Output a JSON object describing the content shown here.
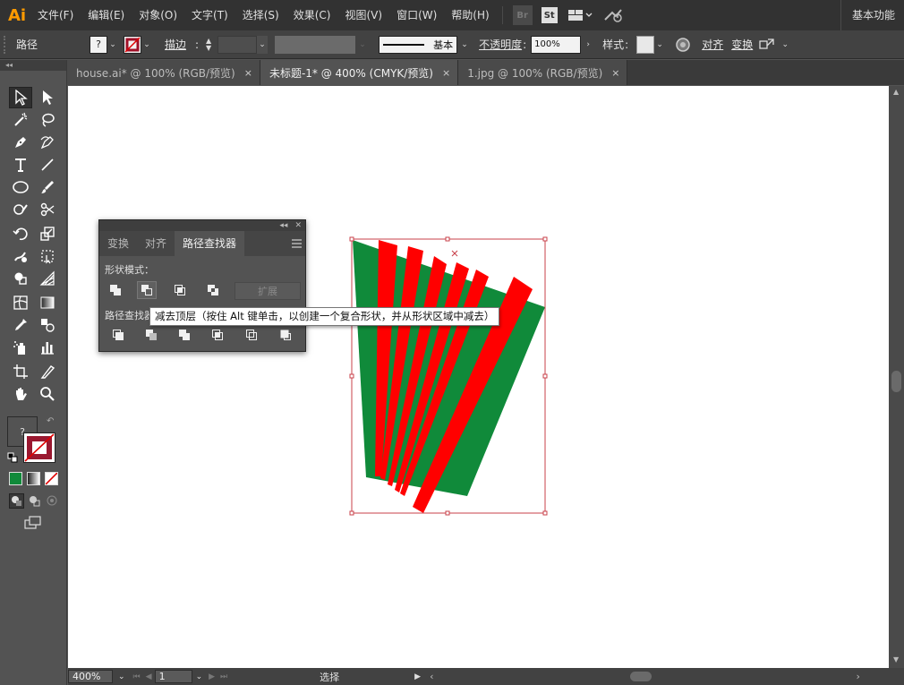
{
  "app": {
    "logo": "Ai",
    "workspace": "基本功能"
  },
  "menu": [
    "文件(F)",
    "编辑(E)",
    "对象(O)",
    "文字(T)",
    "选择(S)",
    "效果(C)",
    "视图(V)",
    "窗口(W)",
    "帮助(H)"
  ],
  "menubar_icons": {
    "bridge": "Br",
    "stock": "St"
  },
  "control_bar": {
    "selection_type": "路径",
    "fill_value": "?",
    "stroke_label": "描边",
    "brush_label": "基本",
    "opacity_label": "不透明度",
    "opacity_value": "100%",
    "style_label": "样式",
    "align_label": "对齐",
    "transform_label": "变换"
  },
  "tabs": [
    {
      "label": "house.ai* @ 100% (RGB/预览)",
      "close": "×",
      "active": false
    },
    {
      "label": "未标题-1* @ 400% (CMYK/预览)",
      "close": "×",
      "active": true
    },
    {
      "label": "1.jpg @ 100% (RGB/预览)",
      "close": "×",
      "active": false
    }
  ],
  "toolbar": {
    "collapse": "◂◂",
    "fill_unknown": "?"
  },
  "panel": {
    "collapse": "◂◂",
    "close": "✕",
    "tabs": [
      "变换",
      "对齐",
      "路径查找器"
    ],
    "active_tab": "路径查找器",
    "shape_modes_label": "形状模式：",
    "pathfinders_label": "路径查找器：",
    "expand_label": "扩展"
  },
  "tooltip": "减去顶层（按住 Alt 键单击，以创建一个复合形状，并从形状区域中减去）",
  "status": {
    "zoom": "400%",
    "page": "1",
    "tool": "选择"
  },
  "colors": {
    "green": "#108a3a",
    "red": "#ff0000",
    "selection": "#c8404a",
    "accent": "#ff9a00"
  }
}
